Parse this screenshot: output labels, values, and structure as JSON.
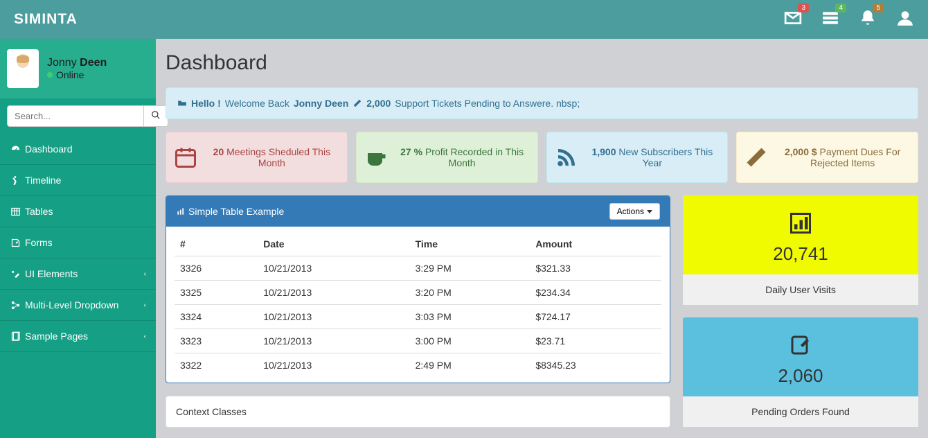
{
  "brand": "SIMINTA",
  "nav": {
    "mail_badge": "3",
    "task_badge": "4",
    "bell_badge": "5"
  },
  "user": {
    "first": "Jonny ",
    "last": "Deen",
    "status": "Online"
  },
  "search": {
    "placeholder": "Search..."
  },
  "sidebar": {
    "items": [
      {
        "label": "Dashboard"
      },
      {
        "label": "Timeline"
      },
      {
        "label": "Tables"
      },
      {
        "label": "Forms"
      },
      {
        "label": "UI Elements"
      },
      {
        "label": "Multi-Level Dropdown"
      },
      {
        "label": "Sample Pages"
      }
    ]
  },
  "page": {
    "title": "Dashboard"
  },
  "alert": {
    "hello": "Hello !",
    "welcome": " Welcome Back ",
    "user": "Jonny Deen",
    "tickets": "2,000",
    "tickets_text": " Support Tickets Pending to Answere. nbsp;"
  },
  "stats": [
    {
      "value": "20",
      "text": " Meetings Sheduled This Month"
    },
    {
      "value": "27 %",
      "text": " Profit Recorded in This Month"
    },
    {
      "value": "1,900",
      "text": " New Subscribers This Year"
    },
    {
      "value": "2,000 $",
      "text": " Payment Dues For Rejected Items"
    }
  ],
  "table_panel": {
    "title": "Simple Table Example",
    "actions_label": "Actions ",
    "headers": [
      "#",
      "Date",
      "Time",
      "Amount"
    ],
    "rows": [
      {
        "id": "3326",
        "date": "10/21/2013",
        "time": "3:29 PM",
        "amount": "$321.33"
      },
      {
        "id": "3325",
        "date": "10/21/2013",
        "time": "3:20 PM",
        "amount": "$234.34"
      },
      {
        "id": "3324",
        "date": "10/21/2013",
        "time": "3:03 PM",
        "amount": "$724.17"
      },
      {
        "id": "3323",
        "date": "10/21/2013",
        "time": "3:00 PM",
        "amount": "$23.71"
      },
      {
        "id": "3322",
        "date": "10/21/2013",
        "time": "2:49 PM",
        "amount": "$8345.23"
      }
    ]
  },
  "widgets": [
    {
      "value": "20,741",
      "label": "Daily User Visits"
    },
    {
      "value": "2,060",
      "label": "Pending Orders Found"
    }
  ],
  "context_panel": {
    "title": "Context Classes"
  }
}
